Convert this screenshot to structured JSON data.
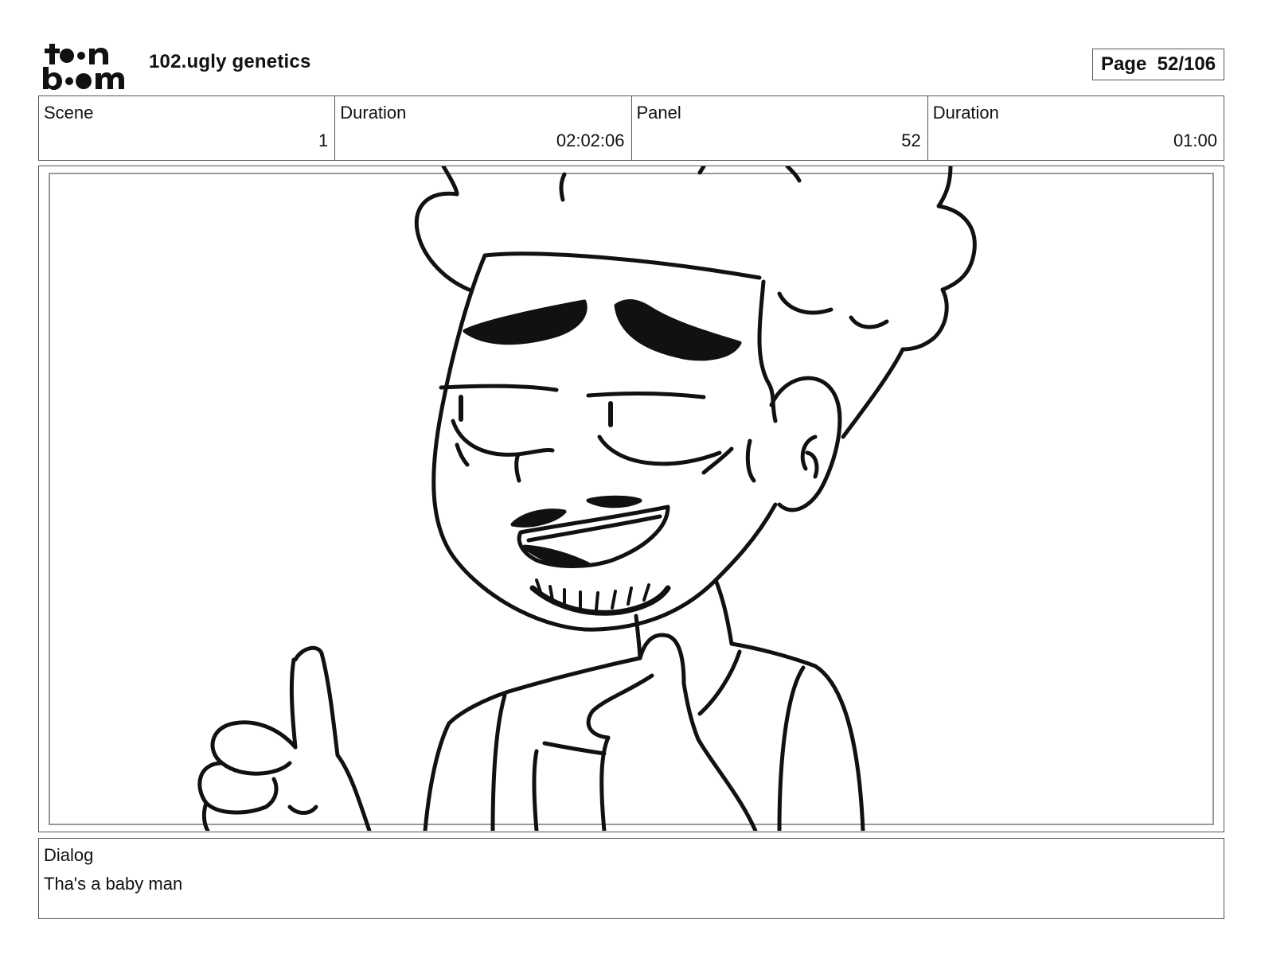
{
  "header": {
    "logo_text": "toonboom",
    "project_title": "102.ugly genetics",
    "page_label": "Page",
    "page_number": "52/106"
  },
  "info": {
    "scene": {
      "label": "Scene",
      "value": "1"
    },
    "scene_duration": {
      "label": "Duration",
      "value": "02:02:06"
    },
    "panel": {
      "label": "Panel",
      "value": "52"
    },
    "panel_duration": {
      "label": "Duration",
      "value": "01:00"
    }
  },
  "dialog": {
    "label": "Dialog",
    "text": "Tha's a baby man"
  }
}
